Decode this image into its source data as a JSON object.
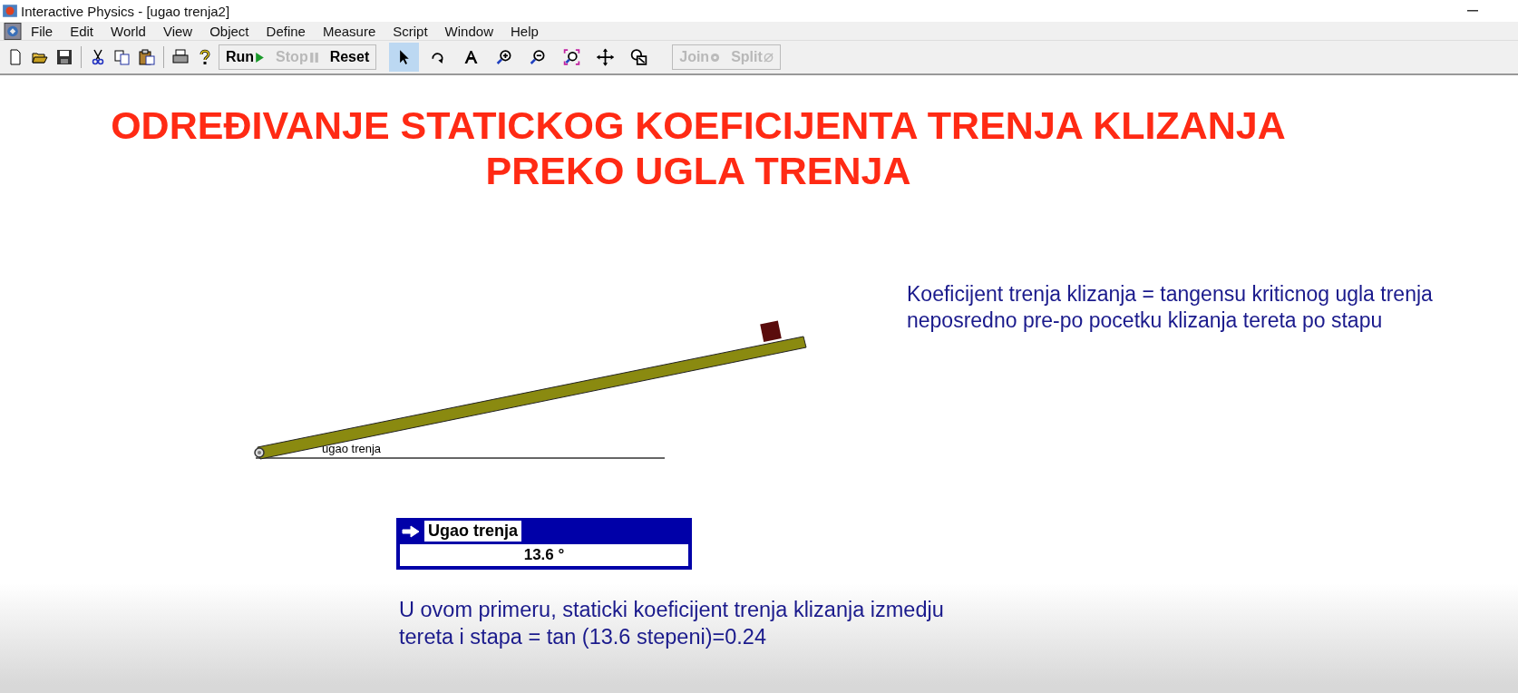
{
  "window": {
    "title": "Interactive Physics - [ugao trenja2]"
  },
  "menu": [
    "File",
    "Edit",
    "World",
    "View",
    "Object",
    "Define",
    "Measure",
    "Script",
    "Window",
    "Help"
  ],
  "toolbar": {
    "file_tools": [
      {
        "kind": "new"
      },
      {
        "kind": "open"
      },
      {
        "kind": "save"
      },
      {
        "kind": "cut"
      },
      {
        "kind": "copy"
      },
      {
        "kind": "paste"
      },
      {
        "kind": "print"
      },
      {
        "kind": "help"
      }
    ],
    "run_buttons": [
      {
        "label": "Run",
        "kind": "run",
        "disabled": false
      },
      {
        "label": "Stop",
        "kind": "stop",
        "disabled": true
      },
      {
        "label": "Reset",
        "kind": "reset",
        "disabled": false
      }
    ],
    "tools": [
      {
        "kind": "pointer",
        "selected": true
      },
      {
        "kind": "rotate",
        "selected": false
      },
      {
        "kind": "text",
        "selected": false
      },
      {
        "kind": "zoom-in",
        "selected": false
      },
      {
        "kind": "zoom-out",
        "selected": false
      },
      {
        "kind": "zoom-fit",
        "selected": false
      },
      {
        "kind": "move",
        "selected": false
      },
      {
        "kind": "shape",
        "selected": false
      }
    ],
    "join_buttons": [
      {
        "label": "Join",
        "kind": "join",
        "disabled": true
      },
      {
        "label": "Split",
        "kind": "split",
        "disabled": true
      }
    ]
  },
  "canvas": {
    "heading": [
      "ODREĐIVANJE STATICKOG KOEFICIJENTA TRENJA KLIZANJA",
      "PREKO UGLA TRENJA"
    ],
    "note": [
      "Koeficijent trenja klizanja = tangensu kriticnog ugla trenja",
      "neposredno pre-po pocetku klizanja tereta po stapu"
    ],
    "angle_label": "ugao trenja",
    "meter": {
      "title": "Ugao trenja",
      "value": "13.6 °"
    },
    "conclusion": [
      "U ovom primeru, staticki koeficijent trenja klizanja izmedju",
      "tereta i stapa = tan (13.6 stepeni)=0.24"
    ]
  }
}
